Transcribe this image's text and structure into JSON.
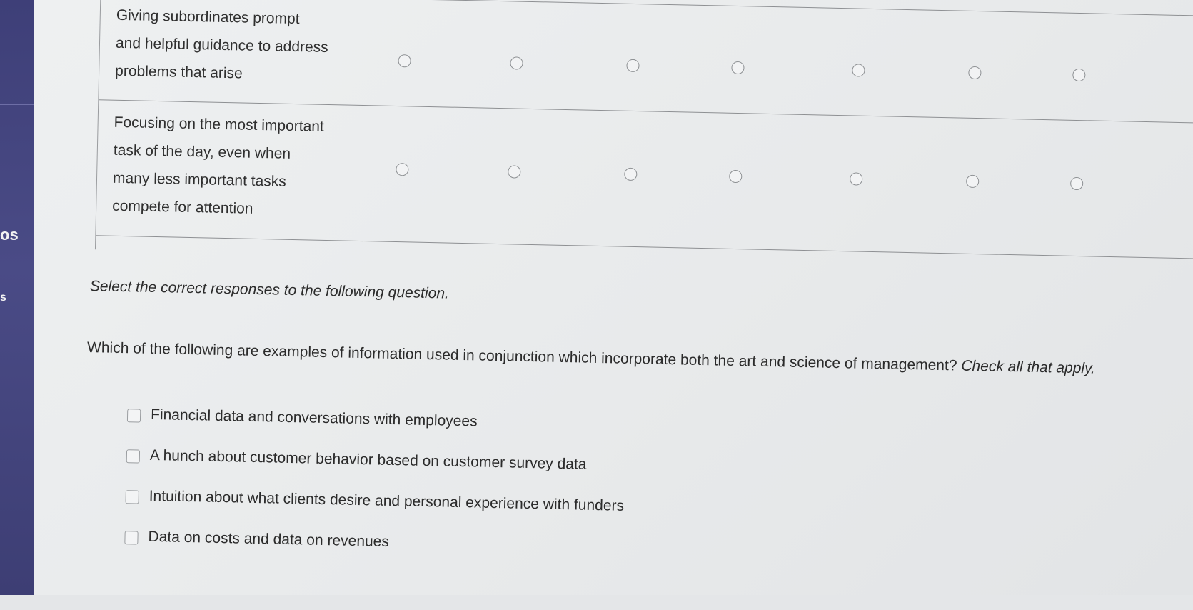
{
  "sidebar": {
    "fragment_top": "os",
    "fragment_bottom": "s"
  },
  "table": {
    "rows": [
      {
        "label_lines": [
          "Giving subordinates prompt",
          "and helpful guidance to address",
          "problems that arise"
        ],
        "options_count": 7
      },
      {
        "label_lines": [
          "Focusing on the most important",
          "task of the day, even when",
          "many less important tasks",
          "compete for attention"
        ],
        "options_count": 7
      }
    ]
  },
  "question": {
    "instructions": "Select the correct responses to the following question.",
    "text": "Which of the following are examples of information used in conjunction which incorporate both the art and science of management?",
    "hint": "Check all that apply.",
    "options": [
      {
        "label": "Financial data and conversations with employees",
        "checked": false
      },
      {
        "label": "A hunch about customer behavior based on customer survey data",
        "checked": false
      },
      {
        "label": "Intuition about what clients desire and personal experience with funders",
        "checked": false
      },
      {
        "label": "Data on costs and data on revenues",
        "checked": false
      }
    ]
  }
}
